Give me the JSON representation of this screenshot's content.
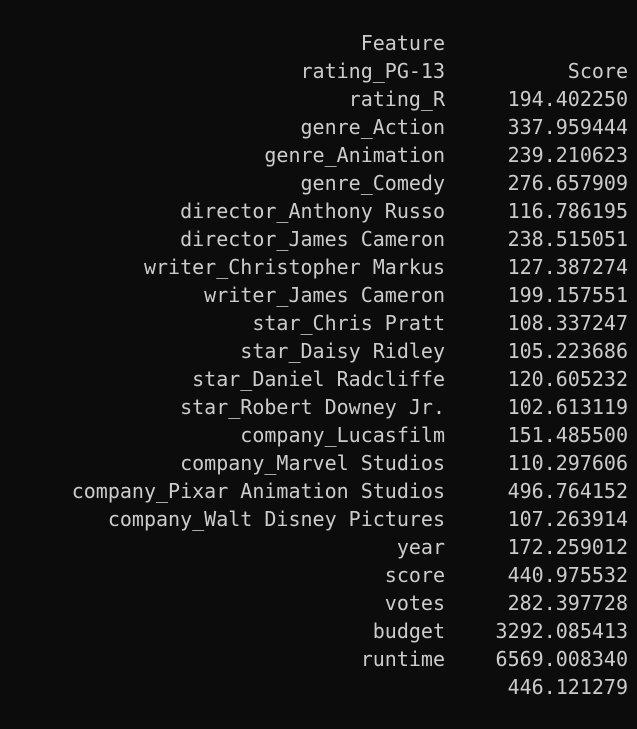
{
  "table": {
    "headers": {
      "feature": "Feature",
      "score": "Score"
    },
    "rows": [
      {
        "feature": "rating_PG-13",
        "score": "194.402250"
      },
      {
        "feature": "rating_R",
        "score": "337.959444"
      },
      {
        "feature": "genre_Action",
        "score": "239.210623"
      },
      {
        "feature": "genre_Animation",
        "score": "276.657909"
      },
      {
        "feature": "genre_Comedy",
        "score": "116.786195"
      },
      {
        "feature": "director_Anthony Russo",
        "score": "238.515051"
      },
      {
        "feature": "director_James Cameron",
        "score": "127.387274"
      },
      {
        "feature": "writer_Christopher Markus",
        "score": "199.157551"
      },
      {
        "feature": "writer_James Cameron",
        "score": "108.337247"
      },
      {
        "feature": "star_Chris Pratt",
        "score": "105.223686"
      },
      {
        "feature": "star_Daisy Ridley",
        "score": "120.605232"
      },
      {
        "feature": "star_Daniel Radcliffe",
        "score": "102.613119"
      },
      {
        "feature": "star_Robert Downey Jr.",
        "score": "151.485500"
      },
      {
        "feature": "company_Lucasfilm",
        "score": "110.297606"
      },
      {
        "feature": "company_Marvel Studios",
        "score": "496.764152"
      },
      {
        "feature": "company_Pixar Animation Studios",
        "score": "107.263914"
      },
      {
        "feature": "company_Walt Disney Pictures",
        "score": "172.259012"
      },
      {
        "feature": "year",
        "score": "440.975532"
      },
      {
        "feature": "score",
        "score": "282.397728"
      },
      {
        "feature": "votes",
        "score": "3292.085413"
      },
      {
        "feature": "budget",
        "score": "6569.008340"
      },
      {
        "feature": "runtime",
        "score": "446.121279"
      }
    ]
  }
}
